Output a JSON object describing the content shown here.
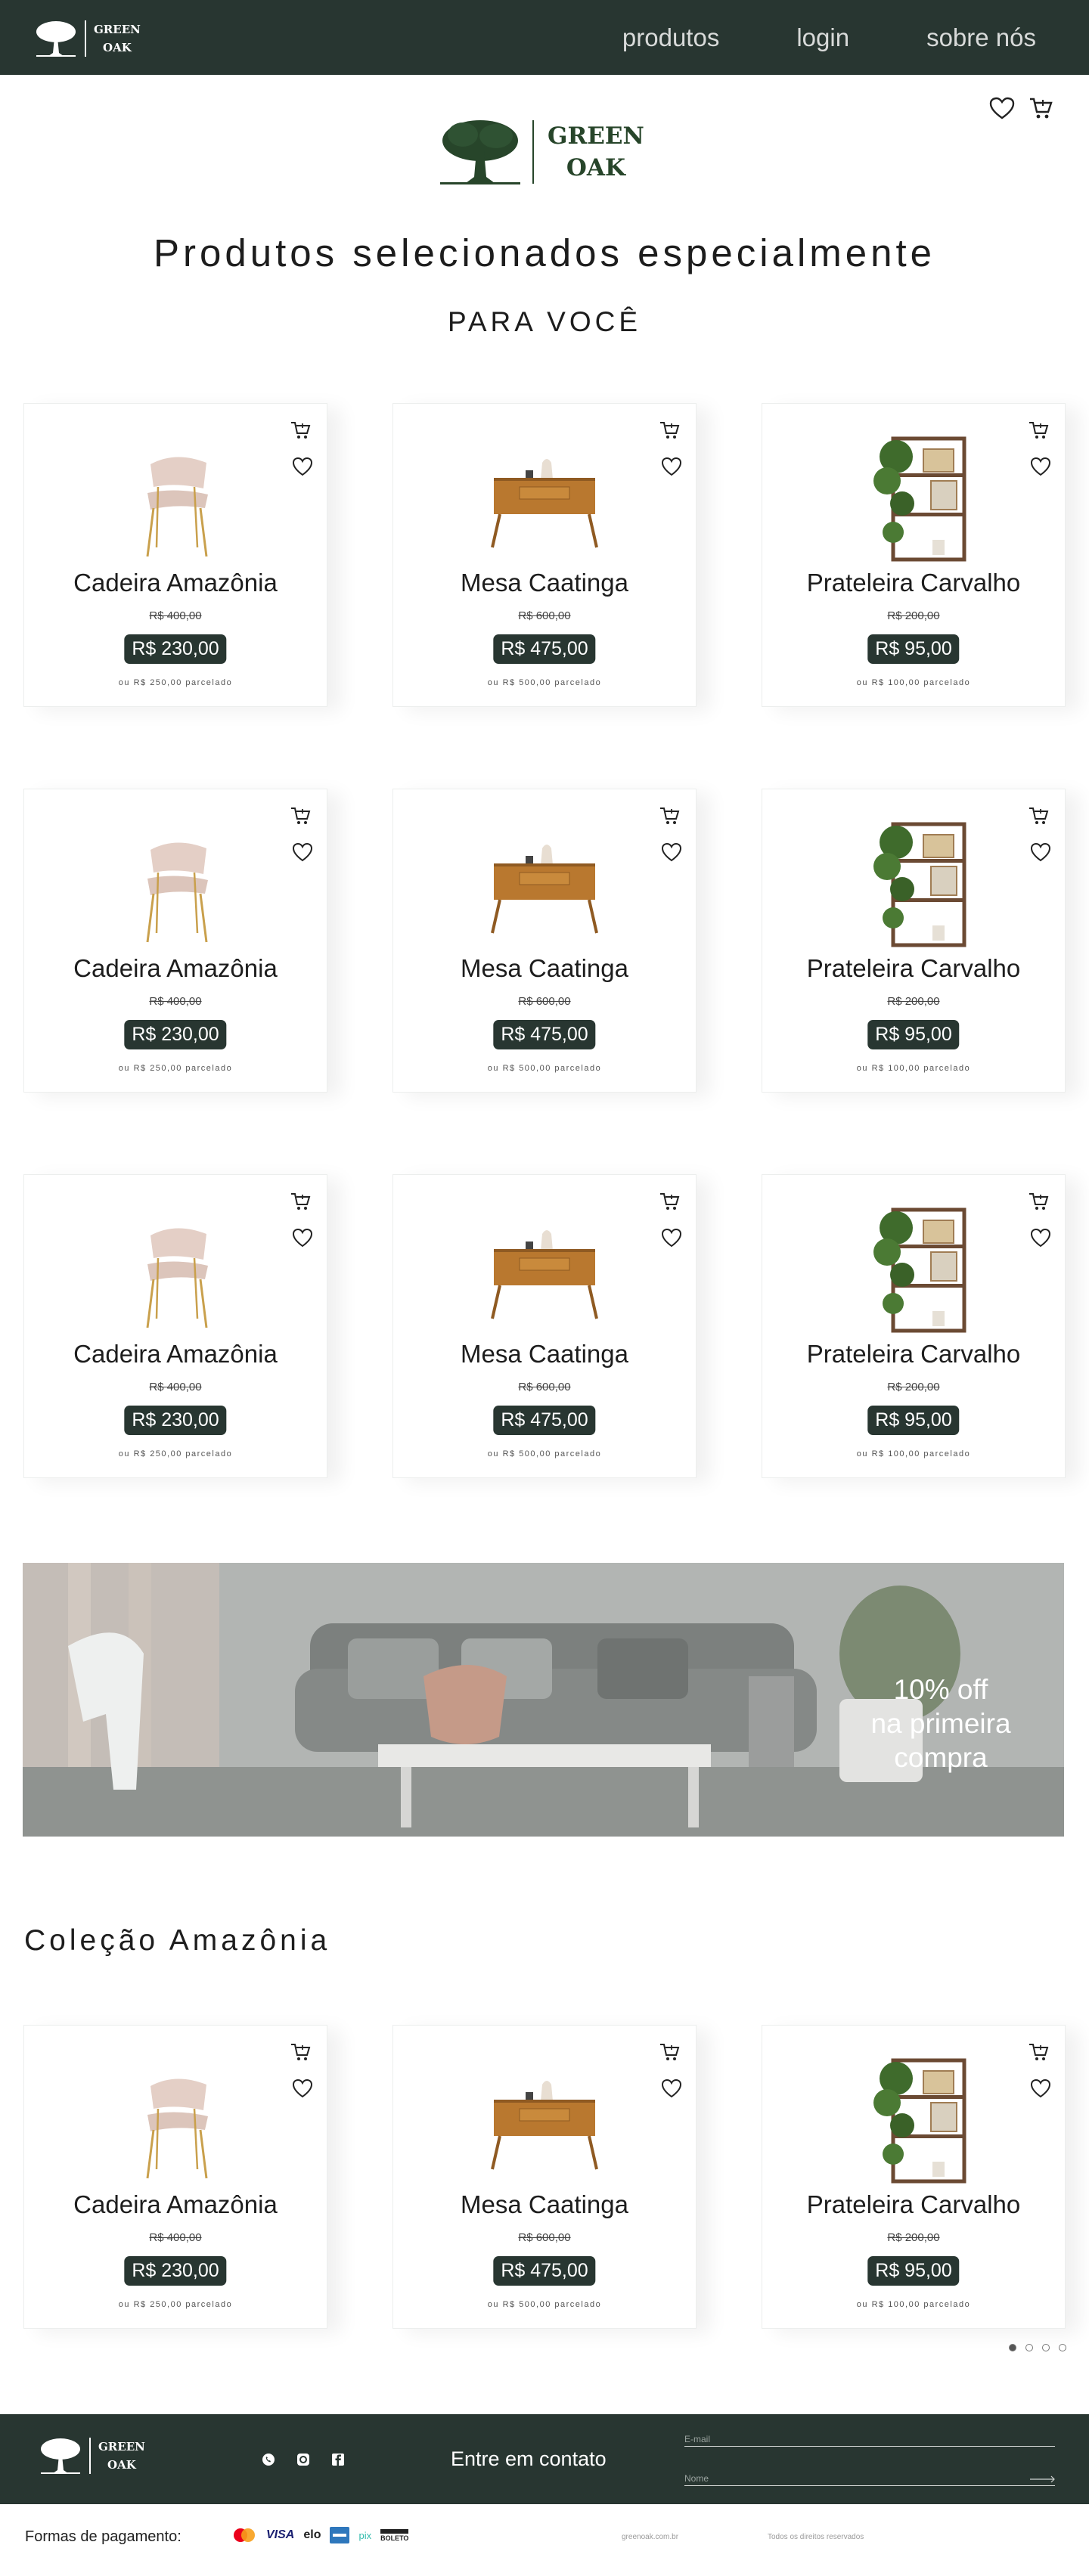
{
  "header": {
    "brand_line1": "GREEN",
    "brand_line2": "OAK",
    "nav": [
      "produtos",
      "login",
      "sobre nós"
    ]
  },
  "hero": {
    "logo_line1": "GREEN",
    "logo_line2": "OAK",
    "title": "Produtos selecionados especialmente",
    "subtitle": "PARA VOCÊ"
  },
  "icons": {
    "heart": "heart-icon",
    "cart": "cart-icon",
    "whatsapp": "whatsapp-icon",
    "instagram": "instagram-icon",
    "facebook": "facebook-icon"
  },
  "colors": {
    "primary": "#283631",
    "logo_green": "#27452a"
  },
  "products": [
    {
      "name": "Cadeira Amazônia",
      "old_price": "R$ 400,00",
      "price": "R$ 230,00",
      "installment": "ou R$ 250,00 parcelado",
      "image": "chair"
    },
    {
      "name": "Mesa Caatinga",
      "old_price": "R$ 600,00",
      "price": "R$ 475,00",
      "installment": "ou R$ 500,00 parcelado",
      "image": "sideboard"
    },
    {
      "name": "Prateleira Carvalho",
      "old_price": "R$ 200,00",
      "price": "R$ 95,00",
      "installment": "ou R$ 100,00 parcelado",
      "image": "shelf"
    }
  ],
  "promo": {
    "line1": "10% off",
    "line2": "na primeira",
    "line3": "compra"
  },
  "collection": {
    "title": "Coleção Amazônia"
  },
  "carousel": {
    "dot_count": 4,
    "active": 0
  },
  "footer": {
    "brand_line1": "GREEN",
    "brand_line2": "OAK",
    "contact_title": "Entre em contato",
    "email_placeholder": "E-mail",
    "name_placeholder": "Nome",
    "payment_label": "Formas de pagamento:",
    "payments": [
      "mastercard-icon",
      "VISA",
      "elo",
      "amex-icon",
      "pix",
      "BOLETO"
    ],
    "site": "greenoak.com.br",
    "rights": "Todos os direitos reservados"
  }
}
